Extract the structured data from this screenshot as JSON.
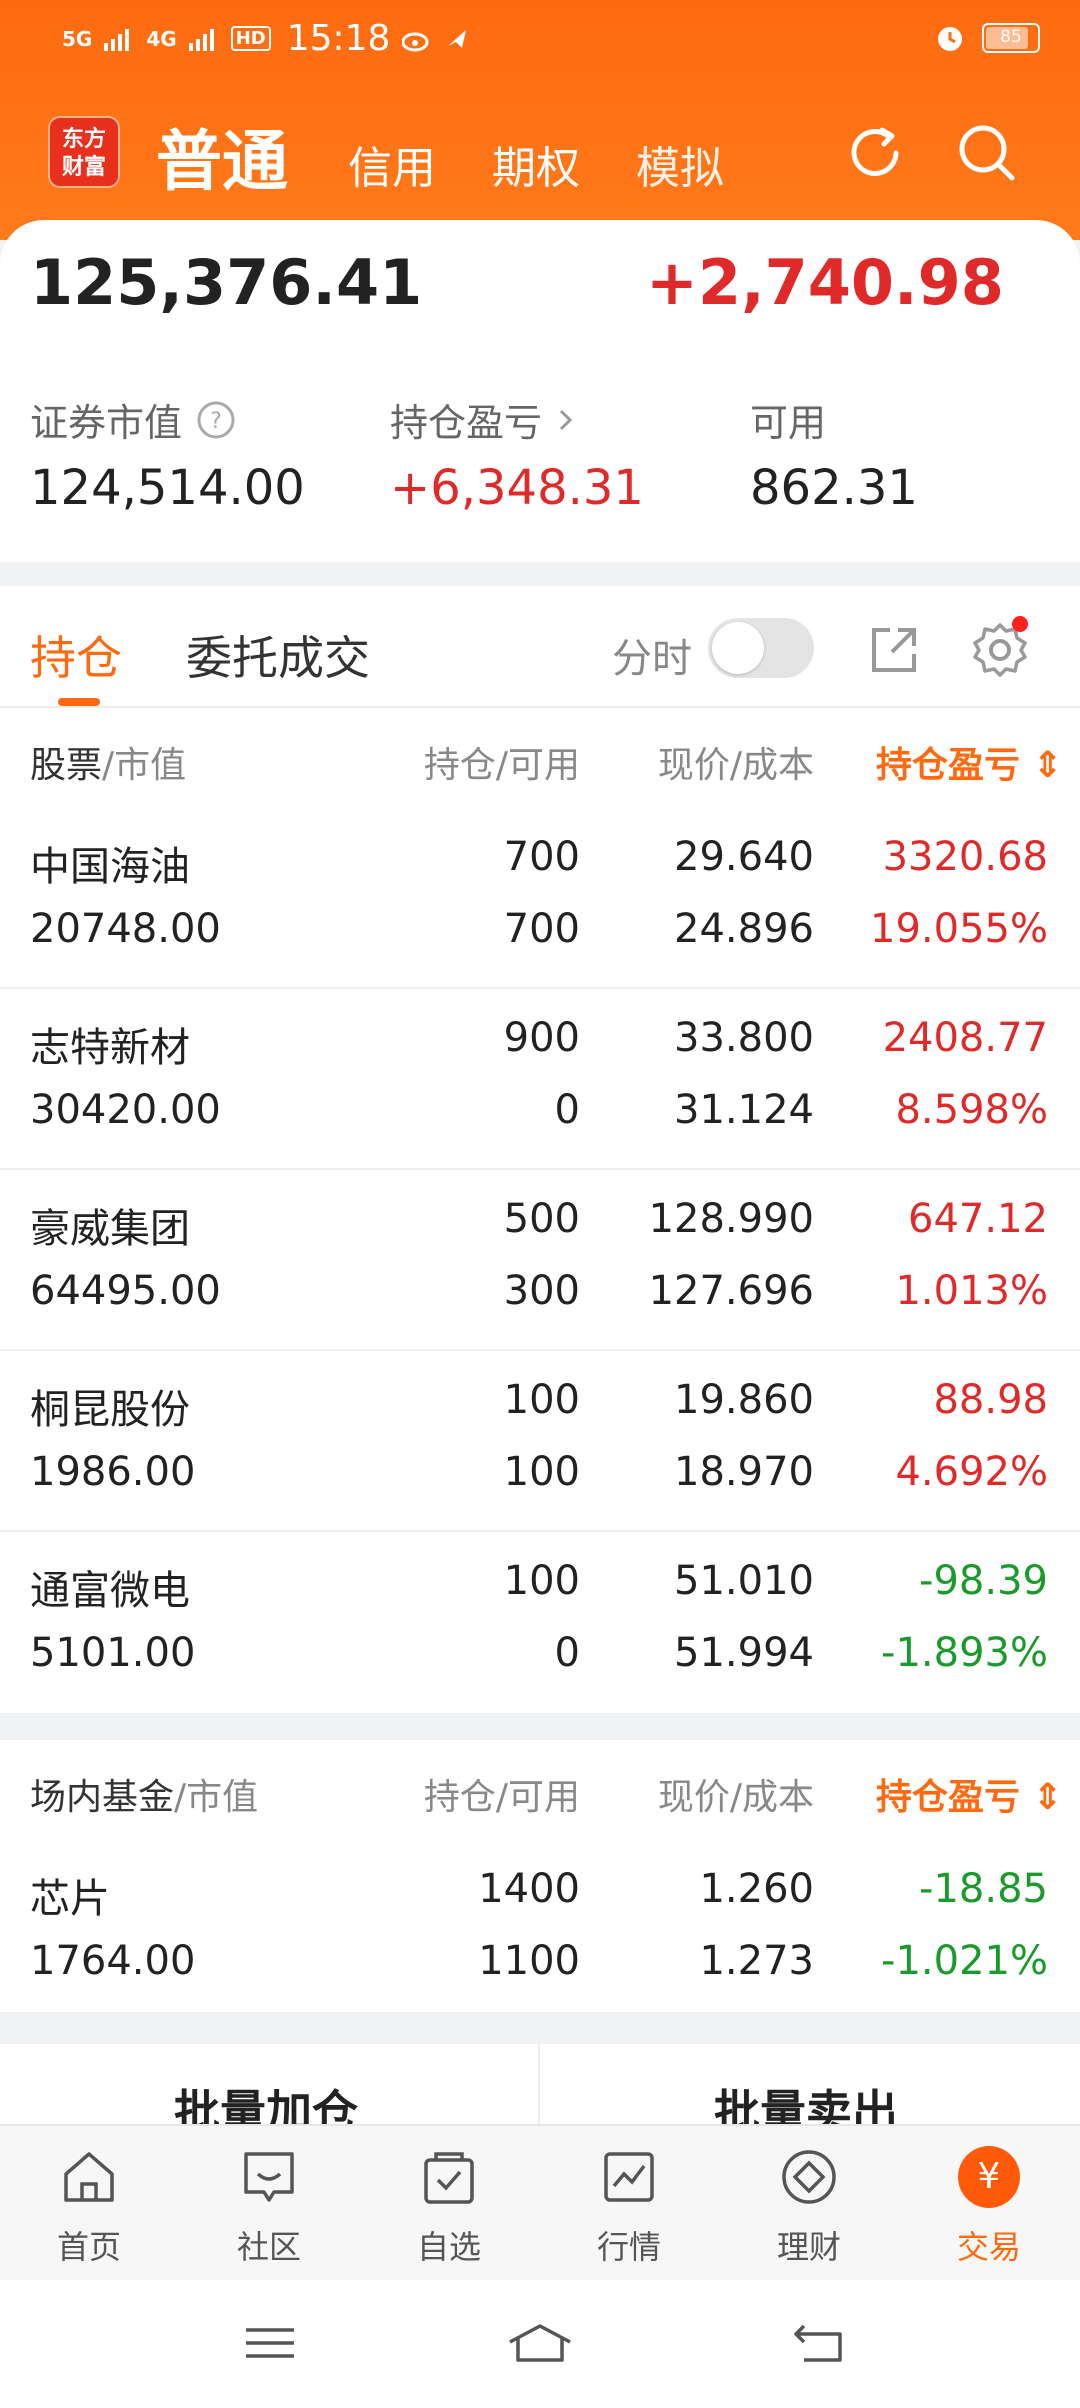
{
  "status_bar": {
    "signal_1": "5G",
    "signal_2": "4G",
    "hd": "HD",
    "time": "15:18",
    "battery": "85"
  },
  "header": {
    "logo_line1": "东方",
    "logo_line2": "财富",
    "mode_active": "普通",
    "mode_tabs": [
      "信用",
      "期权",
      "模拟"
    ],
    "accent_color": "#ff6a10"
  },
  "summary": {
    "total_assets": "125,376.41",
    "today_pl": "+2,740.98",
    "stats": [
      {
        "label": "证券市值",
        "value": "124,514.00"
      },
      {
        "label": "持仓盈亏",
        "value": "+6,348.31"
      },
      {
        "label": "可用",
        "value": "862.31"
      }
    ]
  },
  "tabs": {
    "holdings": "持仓",
    "orders": "委托成交",
    "fenshi": "分时"
  },
  "stocks": {
    "headers": {
      "name": "股票",
      "name_sub": "/市值",
      "qty": "持仓/可用",
      "price": "现价/成本",
      "pl": "持仓盈亏"
    },
    "rows": [
      {
        "name": "中国海油",
        "market_value": "20748.00",
        "hold": "700",
        "avail": "700",
        "price": "29.640",
        "cost": "24.896",
        "pl": "3320.68",
        "pl_pct": "19.055%",
        "trend": "up"
      },
      {
        "name": "志特新材",
        "market_value": "30420.00",
        "hold": "900",
        "avail": "0",
        "price": "33.800",
        "cost": "31.124",
        "pl": "2408.77",
        "pl_pct": "8.598%",
        "trend": "up"
      },
      {
        "name": "豪威集团",
        "market_value": "64495.00",
        "hold": "500",
        "avail": "300",
        "price": "128.990",
        "cost": "127.696",
        "pl": "647.12",
        "pl_pct": "1.013%",
        "trend": "up"
      },
      {
        "name": "桐昆股份",
        "market_value": "1986.00",
        "hold": "100",
        "avail": "100",
        "price": "19.860",
        "cost": "18.970",
        "pl": "88.98",
        "pl_pct": "4.692%",
        "trend": "up"
      },
      {
        "name": "通富微电",
        "market_value": "5101.00",
        "hold": "100",
        "avail": "0",
        "price": "51.010",
        "cost": "51.994",
        "pl": "-98.39",
        "pl_pct": "-1.893%",
        "trend": "down"
      }
    ]
  },
  "funds": {
    "headers": {
      "name": "场内基金",
      "name_sub": "/市值",
      "qty": "持仓/可用",
      "price": "现价/成本",
      "pl": "持仓盈亏"
    },
    "rows": [
      {
        "name": "芯片",
        "market_value": "1764.00",
        "hold": "1400",
        "avail": "1100",
        "price": "1.260",
        "cost": "1.273",
        "pl": "-18.85",
        "pl_pct": "-1.021%",
        "trend": "down"
      }
    ]
  },
  "batch": {
    "add": "批量加仓",
    "sell": "批量卖出"
  },
  "bottom_nav": [
    {
      "label": "首页",
      "icon": "home-icon"
    },
    {
      "label": "社区",
      "icon": "chat-icon"
    },
    {
      "label": "自选",
      "icon": "watchlist-icon"
    },
    {
      "label": "行情",
      "icon": "chart-icon"
    },
    {
      "label": "理财",
      "icon": "diamond-icon"
    },
    {
      "label": "交易",
      "icon": "yuan-icon",
      "glyph": "¥"
    }
  ]
}
